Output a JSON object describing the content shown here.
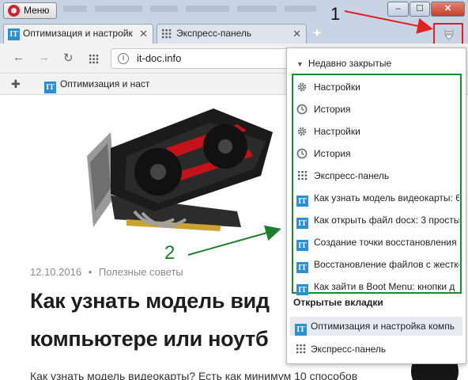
{
  "window": {
    "menu_label": "Меню",
    "controls": [
      "–",
      "☐",
      "✕"
    ]
  },
  "tabs": [
    {
      "label": "Оптимизация и настройк",
      "icon": "it-doc-favicon",
      "close": "✕"
    },
    {
      "label": "Экспресс-панель",
      "icon": "speed-dial-icon",
      "close": "✕"
    }
  ],
  "new_tab_label": "+",
  "address": {
    "url": "it-doc.info",
    "site_icon": "i"
  },
  "bookmarks": {
    "item_label": "Оптимизация и наст"
  },
  "article": {
    "date": "12.10.2016",
    "separator": "•",
    "category": "Полезные советы",
    "title_line1": "Как узнать модель вид",
    "title_line2": "компьютере или ноутб",
    "excerpt": "Как узнать модель видеокарты? Есть как минимум 10 способов"
  },
  "annotations": {
    "label_1": "1",
    "label_2": "2",
    "arrow_color_1": "#e02020",
    "arrow_color_2": "#1e7e2c"
  },
  "panel": {
    "recent_header": "Недавно закрытые",
    "recent_items": [
      {
        "label": "Настройки",
        "icon": "gear-icon"
      },
      {
        "label": "История",
        "icon": "clock-icon"
      },
      {
        "label": "Настройки",
        "icon": "gear-icon"
      },
      {
        "label": "История",
        "icon": "clock-icon"
      },
      {
        "label": "Экспресс-панель",
        "icon": "speed-dial-icon"
      },
      {
        "label": "Как узнать модель видеокарты: 6",
        "icon": "it-doc-favicon"
      },
      {
        "label": "Как открыть файл docx: 3 просты",
        "icon": "it-doc-favicon"
      },
      {
        "label": "Создание точки восстановления",
        "icon": "it-doc-favicon"
      },
      {
        "label": "Восстановление файлов с жестко",
        "icon": "it-doc-favicon"
      },
      {
        "label": "Как зайти в Boot Menu: кнопки д",
        "icon": "it-doc-favicon"
      }
    ],
    "open_tabs_header": "Открытые вкладки",
    "open_tabs": [
      {
        "label": "Оптимизация и настройка компь",
        "icon": "it-doc-favicon"
      },
      {
        "label": "Экспресс-панель",
        "icon": "speed-dial-icon"
      }
    ],
    "favicon_text": "IT"
  }
}
